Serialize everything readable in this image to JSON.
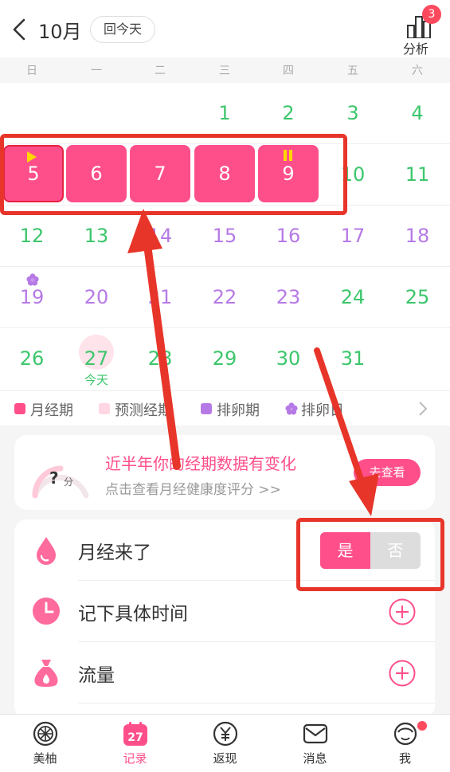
{
  "header": {
    "month": "10月",
    "today_button": "回今天",
    "analysis_label": "分析",
    "analysis_badge": "3"
  },
  "weekdays": [
    "日",
    "一",
    "二",
    "三",
    "四",
    "五",
    "六"
  ],
  "calendar": {
    "row1": [
      "1",
      "2",
      "3",
      "4"
    ],
    "period_days": [
      "5",
      "6",
      "7",
      "8",
      "9"
    ],
    "row2_rest": [
      "10",
      "11"
    ],
    "row3": [
      "12",
      "13",
      "14",
      "15",
      "16",
      "17",
      "18"
    ],
    "row4": [
      "19",
      "20",
      "21",
      "22",
      "23",
      "24",
      "25"
    ],
    "row5": [
      "26",
      "27",
      "28",
      "29",
      "30",
      "31"
    ],
    "today_label": "今天"
  },
  "legend": {
    "items": [
      "月经期",
      "预测经期",
      "排卵期",
      "排卵日"
    ],
    "colors": {
      "period": "#ff4f8b",
      "predicted": "#ffd6e2",
      "ovulation_period": "#b67ae6",
      "ovulation_day": "#b67ae6"
    }
  },
  "info_card": {
    "score": "?",
    "score_unit": "分",
    "title": "近半年你的经期数据有变化",
    "subtitle": "点击查看月经健康度评分 >>",
    "button": "去查看"
  },
  "records": {
    "period_came": "月经来了",
    "yes": "是",
    "no": "否",
    "record_time": "记下具体时间",
    "flow": "流量"
  },
  "tabs": [
    "美柚",
    "记录",
    "返现",
    "消息",
    "我"
  ],
  "tab_record_date": "27",
  "accent_color": "#ff4f8b"
}
